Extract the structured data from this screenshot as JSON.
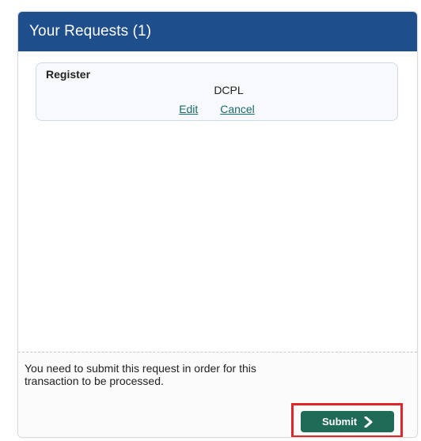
{
  "panel": {
    "title": "Your Requests (1)"
  },
  "request": {
    "type": "Register",
    "detail": "DCPL",
    "edit_label": "Edit",
    "cancel_label": "Cancel"
  },
  "footer": {
    "message": "You need to submit this request in order for this transaction to be processed.",
    "submit_label": "Submit",
    "submit_icon": "chevron-right-icon"
  },
  "colors": {
    "header_bg": "#1f4e8c",
    "submit_bg": "#1f6b57",
    "link": "#1a6b6b",
    "highlight": "#e0262a"
  }
}
